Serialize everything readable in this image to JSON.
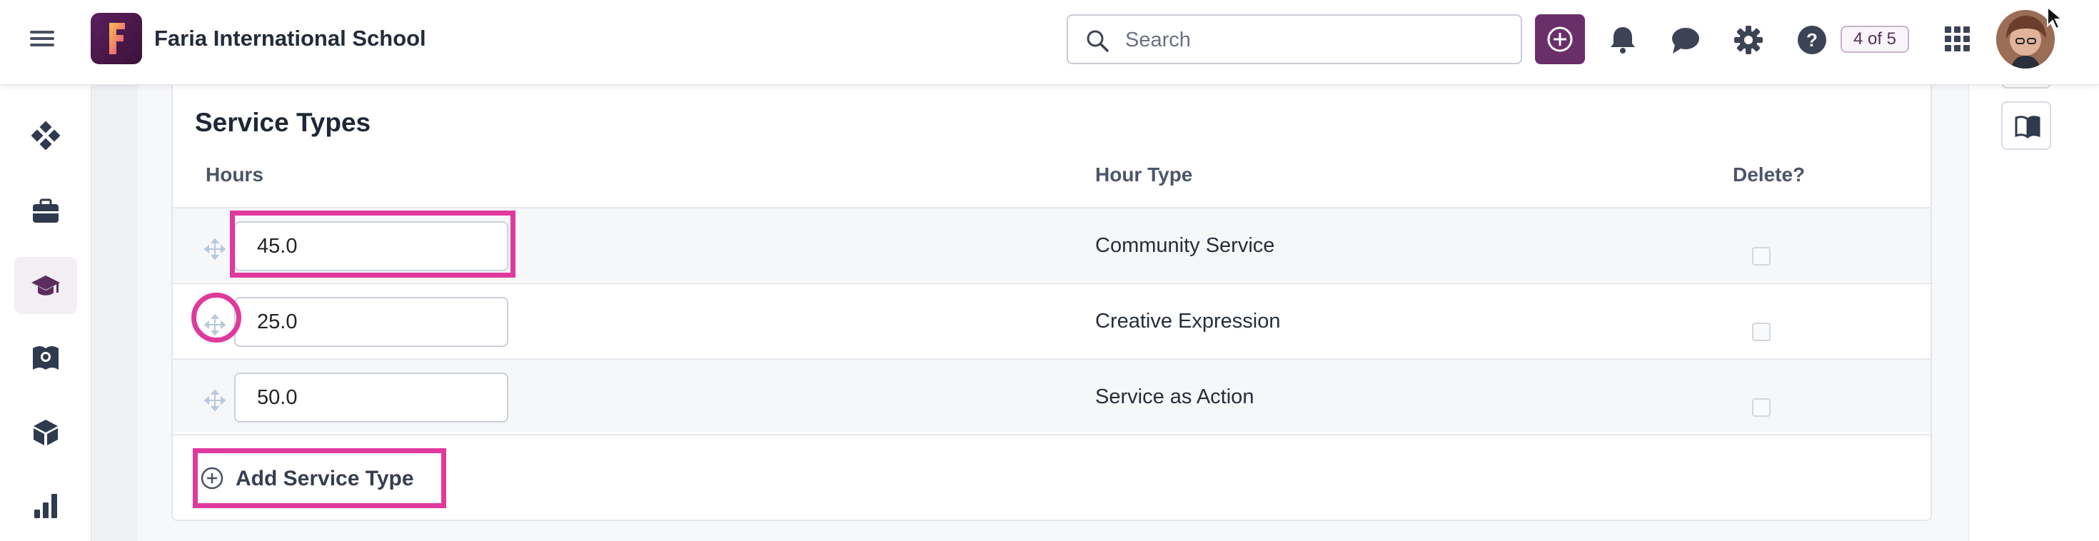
{
  "header": {
    "school_name": "Faria International School",
    "logo_letter": "F",
    "search_placeholder": "Search",
    "pager_label": "4 of 5",
    "icons": [
      "menu-icon",
      "plus-circle-icon",
      "bell-icon",
      "chat-icon",
      "gear-icon",
      "help-icon",
      "apps-grid-icon",
      "user-avatar"
    ]
  },
  "sidebar": {
    "items": [
      {
        "name": "dashboard",
        "icon": "diamond-grid-icon",
        "active": false
      },
      {
        "name": "briefcase",
        "icon": "briefcase-icon",
        "active": false
      },
      {
        "name": "programme",
        "icon": "graduation-cap-icon",
        "active": true
      },
      {
        "name": "library",
        "icon": "book-globe-icon",
        "active": false
      },
      {
        "name": "resources",
        "icon": "cube-icon",
        "active": false
      },
      {
        "name": "reports",
        "icon": "bar-chart-icon",
        "active": false
      }
    ]
  },
  "right_rail": {
    "icons": [
      "open-book-icon"
    ]
  },
  "card": {
    "title": "Service Types",
    "columns": {
      "hours": "Hours",
      "hour_type": "Hour Type",
      "delete": "Delete?"
    },
    "rows": [
      {
        "hours": "45.0",
        "hour_type": "Community Service",
        "delete": false
      },
      {
        "hours": "25.0",
        "hour_type": "Creative Expression",
        "delete": false
      },
      {
        "hours": "50.0",
        "hour_type": "Service as Action",
        "delete": false
      }
    ],
    "add_label": "Add Service Type"
  },
  "colors": {
    "accent": "#6a2f69",
    "highlight": "#e0399d",
    "sidebar_active": "#f3edf4"
  }
}
